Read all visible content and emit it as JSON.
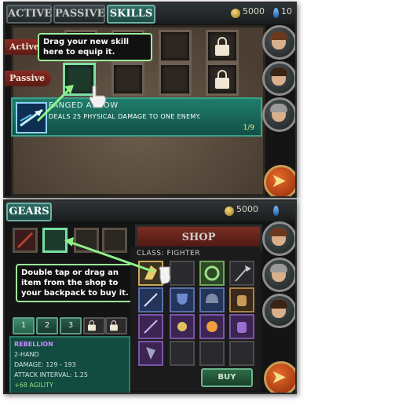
{
  "top_panel": {
    "tabs": [
      {
        "label": "ACTIVE"
      },
      {
        "label": "PASSIVE"
      },
      {
        "label": "SKILLS"
      }
    ],
    "gold": "5000",
    "gems": "10",
    "row_labels": {
      "active": "Active",
      "passive": "Passive"
    },
    "tooltip": "Drag your new skill here to equip it.",
    "skill": {
      "name": "FANGED ARROW",
      "description": "DEALS 25 PHYSICAL DAMAGE TO ONE ENEMY.",
      "count": "1/9",
      "icon": "arrow-skill-icon"
    }
  },
  "bottom_panel": {
    "tab": "GEARS",
    "gold": "5000",
    "shop_title": "SHOP",
    "class_label": "CLASS: FIGHTER",
    "buy_label": "BUY",
    "tooltip": "Double tap or drag an item from the shop to your backpack to buy it.",
    "pages": [
      "1",
      "2",
      "3"
    ],
    "stats": {
      "item_name": "REBELLION",
      "hand": "2-HAND",
      "damage": "DAMAGE: 129 - 193",
      "interval": "ATTACK INTERVAL: 1.25",
      "bonus": "+68 AGILITY"
    }
  },
  "colors": {
    "accent_green": "#7ce0a5",
    "teal": "#1f7d6b",
    "red_label": "#8b2b22"
  }
}
